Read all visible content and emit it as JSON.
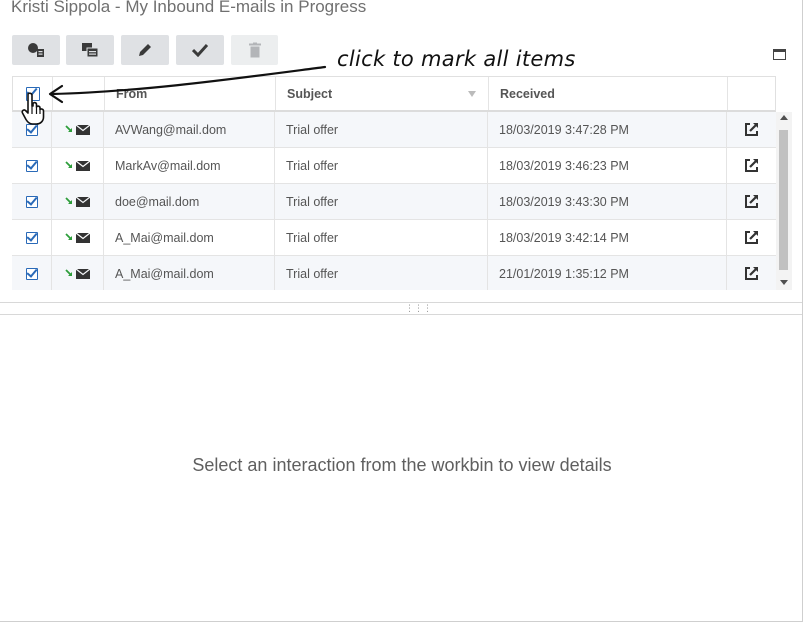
{
  "window": {
    "title": "Kristi Sippola - My Inbound E-mails in Progress"
  },
  "toolbar": {
    "buttons": [
      {
        "name": "workbin-transfer-icon",
        "state": "enabled"
      },
      {
        "name": "workbin-move-icon",
        "state": "enabled"
      },
      {
        "name": "edit-pencil-icon",
        "state": "enabled"
      },
      {
        "name": "mark-done-check-icon",
        "state": "enabled"
      },
      {
        "name": "delete-trash-icon",
        "state": "disabled"
      }
    ]
  },
  "grid": {
    "columns": {
      "from": "From",
      "subject": "Subject",
      "received": "Received"
    },
    "rows": [
      {
        "from": "AVWang@mail.dom",
        "subject": "Trial offer",
        "received": "18/03/2019 3:47:28 PM",
        "checked": true
      },
      {
        "from": "MarkAv@mail.dom",
        "subject": "Trial offer",
        "received": "18/03/2019 3:46:23 PM",
        "checked": true
      },
      {
        "from": "doe@mail.dom",
        "subject": "Trial offer",
        "received": "18/03/2019 3:43:30 PM",
        "checked": true
      },
      {
        "from": "A_Mai@mail.dom",
        "subject": "Trial offer",
        "received": "18/03/2019 3:42:14 PM",
        "checked": true
      },
      {
        "from": "A_Mai@mail.dom",
        "subject": "Trial offer",
        "received": "21/01/2019 1:35:12 PM",
        "checked": true
      }
    ]
  },
  "details": {
    "empty_message": "Select an interaction from the workbin to view details"
  },
  "annotation": {
    "text": "click to mark all items"
  },
  "colors": {
    "checkbox": "#2a6ab8",
    "inbound_arrow": "#2e9e3b",
    "toolbar_button": "#dfe1e4"
  }
}
